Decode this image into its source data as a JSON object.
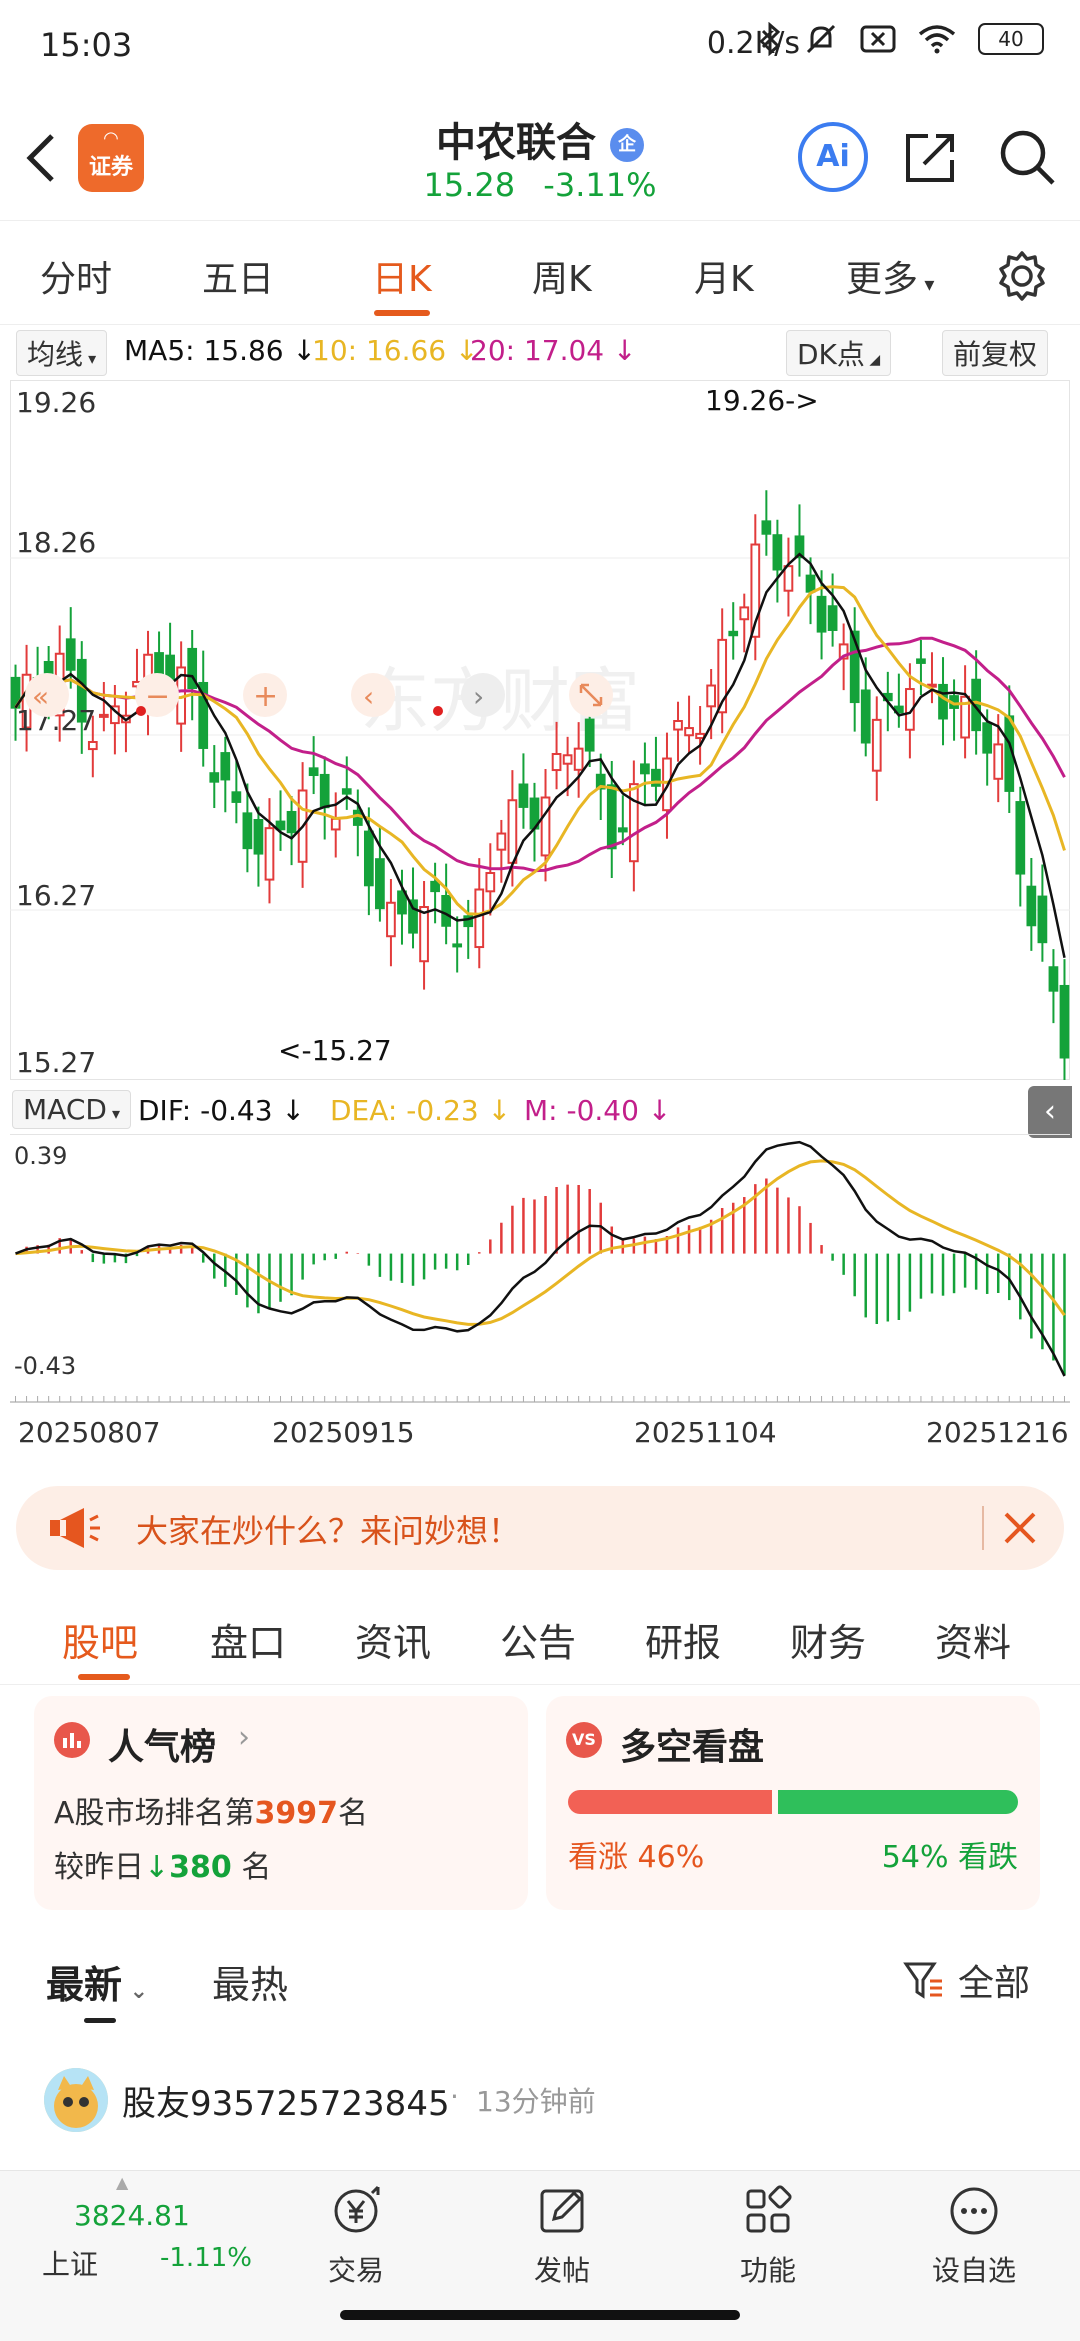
{
  "status_bar": {
    "time": "15:03",
    "net_speed": "0.2K/s",
    "battery": "40"
  },
  "header": {
    "logo_text": "证券",
    "stock_name": "中农联合",
    "stock_badge": "企",
    "price": "15.28",
    "change_pct": "-3.11%",
    "ai_label": "Ai"
  },
  "kline_tabs": [
    {
      "label": "分时"
    },
    {
      "label": "五日"
    },
    {
      "label": "日K",
      "active": true
    },
    {
      "label": "周K"
    },
    {
      "label": "月K"
    },
    {
      "label": "更多"
    }
  ],
  "ma_row": {
    "selector": "均线",
    "ma5": "MA5: 15.86",
    "ma10": "10: 16.66",
    "ma20": "20: 17.04",
    "dk_point": "DK点",
    "adjust": "前复权"
  },
  "kchart": {
    "y_labels": [
      "19.26",
      "18.26",
      "17.27",
      "16.27",
      "15.27"
    ],
    "high_label": "19.26->",
    "low_label": "<-15.27",
    "watermark": "东方财富"
  },
  "macd_row": {
    "selector": "MACD",
    "dif": "DIF: -0.43",
    "dea": "DEA: -0.23",
    "m": "M: -0.40",
    "y_top": "0.39",
    "y_bottom": "-0.43"
  },
  "dates": [
    "20250807",
    "20250915",
    "20251104",
    "20251216"
  ],
  "banner": {
    "text": "大家在炒什么？来问妙想！"
  },
  "content_tabs": [
    {
      "label": "股吧",
      "active": true
    },
    {
      "label": "盘口"
    },
    {
      "label": "资讯"
    },
    {
      "label": "公告"
    },
    {
      "label": "研报"
    },
    {
      "label": "财务"
    },
    {
      "label": "资料"
    }
  ],
  "popularity_card": {
    "title": "人气榜",
    "rank_prefix": "A股市场排名第",
    "rank_value": "3997",
    "rank_suffix": "名",
    "change_prefix": "较昨日",
    "change_value": "380",
    "change_suffix": "名"
  },
  "sentiment_card": {
    "title": "多空看盘",
    "bull_label": "看涨",
    "bull_pct": "46%",
    "bear_pct": "54%",
    "bear_label": "看跌",
    "bull_fraction": 0.46
  },
  "feed": {
    "tab_latest": "最新",
    "tab_hot": "最热",
    "filter": "全部",
    "post_user": "股友935725723845",
    "post_time": "13分钟前"
  },
  "bottom_nav": {
    "index_value": "3824.81",
    "index_name": "上证",
    "index_change": "-1.11%",
    "items": [
      {
        "label": "交易"
      },
      {
        "label": "发帖"
      },
      {
        "label": "功能"
      },
      {
        "label": "设自选"
      }
    ]
  },
  "colors": {
    "accent": "#e55a1d",
    "up": "#e23b3b",
    "down": "#14a23a",
    "ma5": "#111111",
    "ma10": "#e8b624",
    "ma20": "#c21f8a"
  }
}
